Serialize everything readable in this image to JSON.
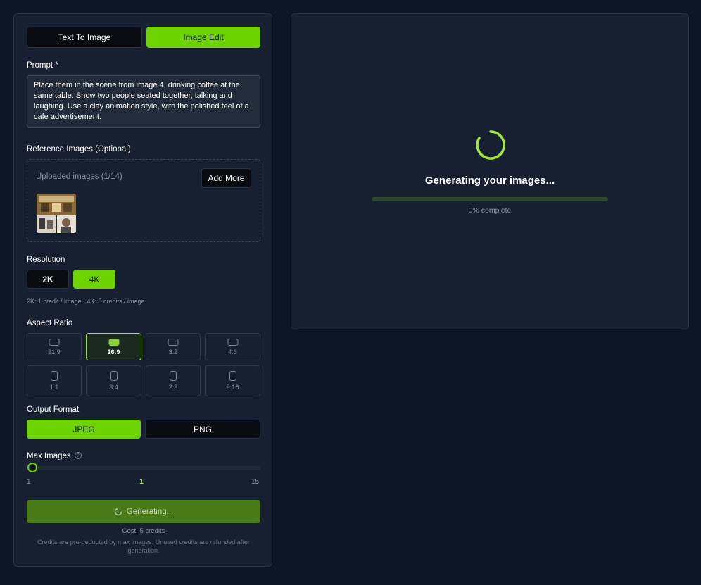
{
  "mode_tabs": {
    "text_to_image": "Text To Image",
    "image_edit": "Image Edit"
  },
  "prompt": {
    "label": "Prompt *",
    "value": "Place them in the scene from image 4, drinking coffee at the same table. Show two people seated together, talking and laughing. Use a clay animation style, with the polished feel of a cafe advertisement."
  },
  "reference": {
    "label": "Reference Images (Optional)",
    "uploaded_text": "Uploaded images (1/14)",
    "add_more": "Add More"
  },
  "resolution": {
    "label": "Resolution",
    "options": [
      "2K",
      "4K"
    ],
    "selected": "4K",
    "hint": "2K: 1 credit / image · 4K: 5 credits / image"
  },
  "aspect_ratio": {
    "label": "Aspect Ratio",
    "options": [
      "21:9",
      "16:9",
      "3:2",
      "4:3",
      "1:1",
      "3:4",
      "2:3",
      "9:16"
    ],
    "selected": "16:9"
  },
  "output_format": {
    "label": "Output Format",
    "options": [
      "JPEG",
      "PNG"
    ],
    "selected": "JPEG"
  },
  "max_images": {
    "label": "Max Images",
    "min": "1",
    "current": "1",
    "max": "15",
    "value": 1
  },
  "generate": {
    "label": "Generating...",
    "cost": "Cost: 5 credits",
    "note": "Credits are pre-deducted by max images. Unused credits are refunded after generation."
  },
  "status": {
    "title": "Generating your images...",
    "progress_text": "0% complete",
    "progress": 0
  },
  "colors": {
    "accent": "#6dd400",
    "background": "#0e1626",
    "panel": "#172030"
  }
}
